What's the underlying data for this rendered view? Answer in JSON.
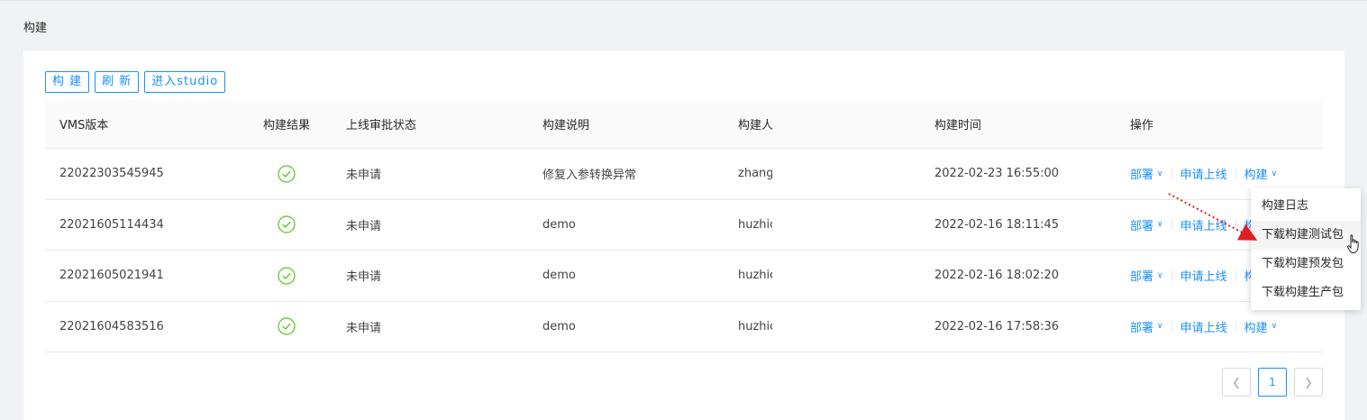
{
  "page": {
    "title": "构建"
  },
  "toolbar": {
    "build_label": "构 建",
    "refresh_label": "刷 新",
    "studio_label": "进入studio"
  },
  "table": {
    "headers": [
      "VMS版本",
      "构建结果",
      "上线审批状态",
      "构建说明",
      "构建人",
      "构建时间",
      "操作"
    ],
    "rows": [
      {
        "version": "22022303545945",
        "result": "success",
        "status": "未申请",
        "desc": "修复入参转换异常",
        "builder": "zhang",
        "time": "2022-02-23 16:55:00"
      },
      {
        "version": "22021605114434",
        "result": "success",
        "status": "未申请",
        "desc": "demo",
        "builder": "huzhic",
        "time": "2022-02-16 18:11:45"
      },
      {
        "version": "22021605021941",
        "result": "success",
        "status": "未申请",
        "desc": "demo",
        "builder": "huzhic",
        "time": "2022-02-16 18:02:20"
      },
      {
        "version": "22021604583516",
        "result": "success",
        "status": "未申请",
        "desc": "demo",
        "builder": "huzhic",
        "time": "2022-02-16 17:58:36"
      }
    ]
  },
  "actions": {
    "deploy_label": "部署",
    "apply_label": "申请上线",
    "build_label": "构建"
  },
  "dropdown": {
    "items": [
      "构建日志",
      "下载构建测试包",
      "下载构建预发包",
      "下载构建生产包"
    ],
    "hovered_index": 1
  },
  "pagination": {
    "current_page": "1"
  },
  "icons": {
    "result": "check-circle-icon",
    "chevron": "chevron-down-icon",
    "prev": "chevron-left-icon",
    "next": "chevron-right-icon",
    "cursor": "hand-pointer-icon"
  },
  "colors": {
    "primary": "#1890ff",
    "success": "#52c41a",
    "annotation_arrow": "#e02020"
  }
}
